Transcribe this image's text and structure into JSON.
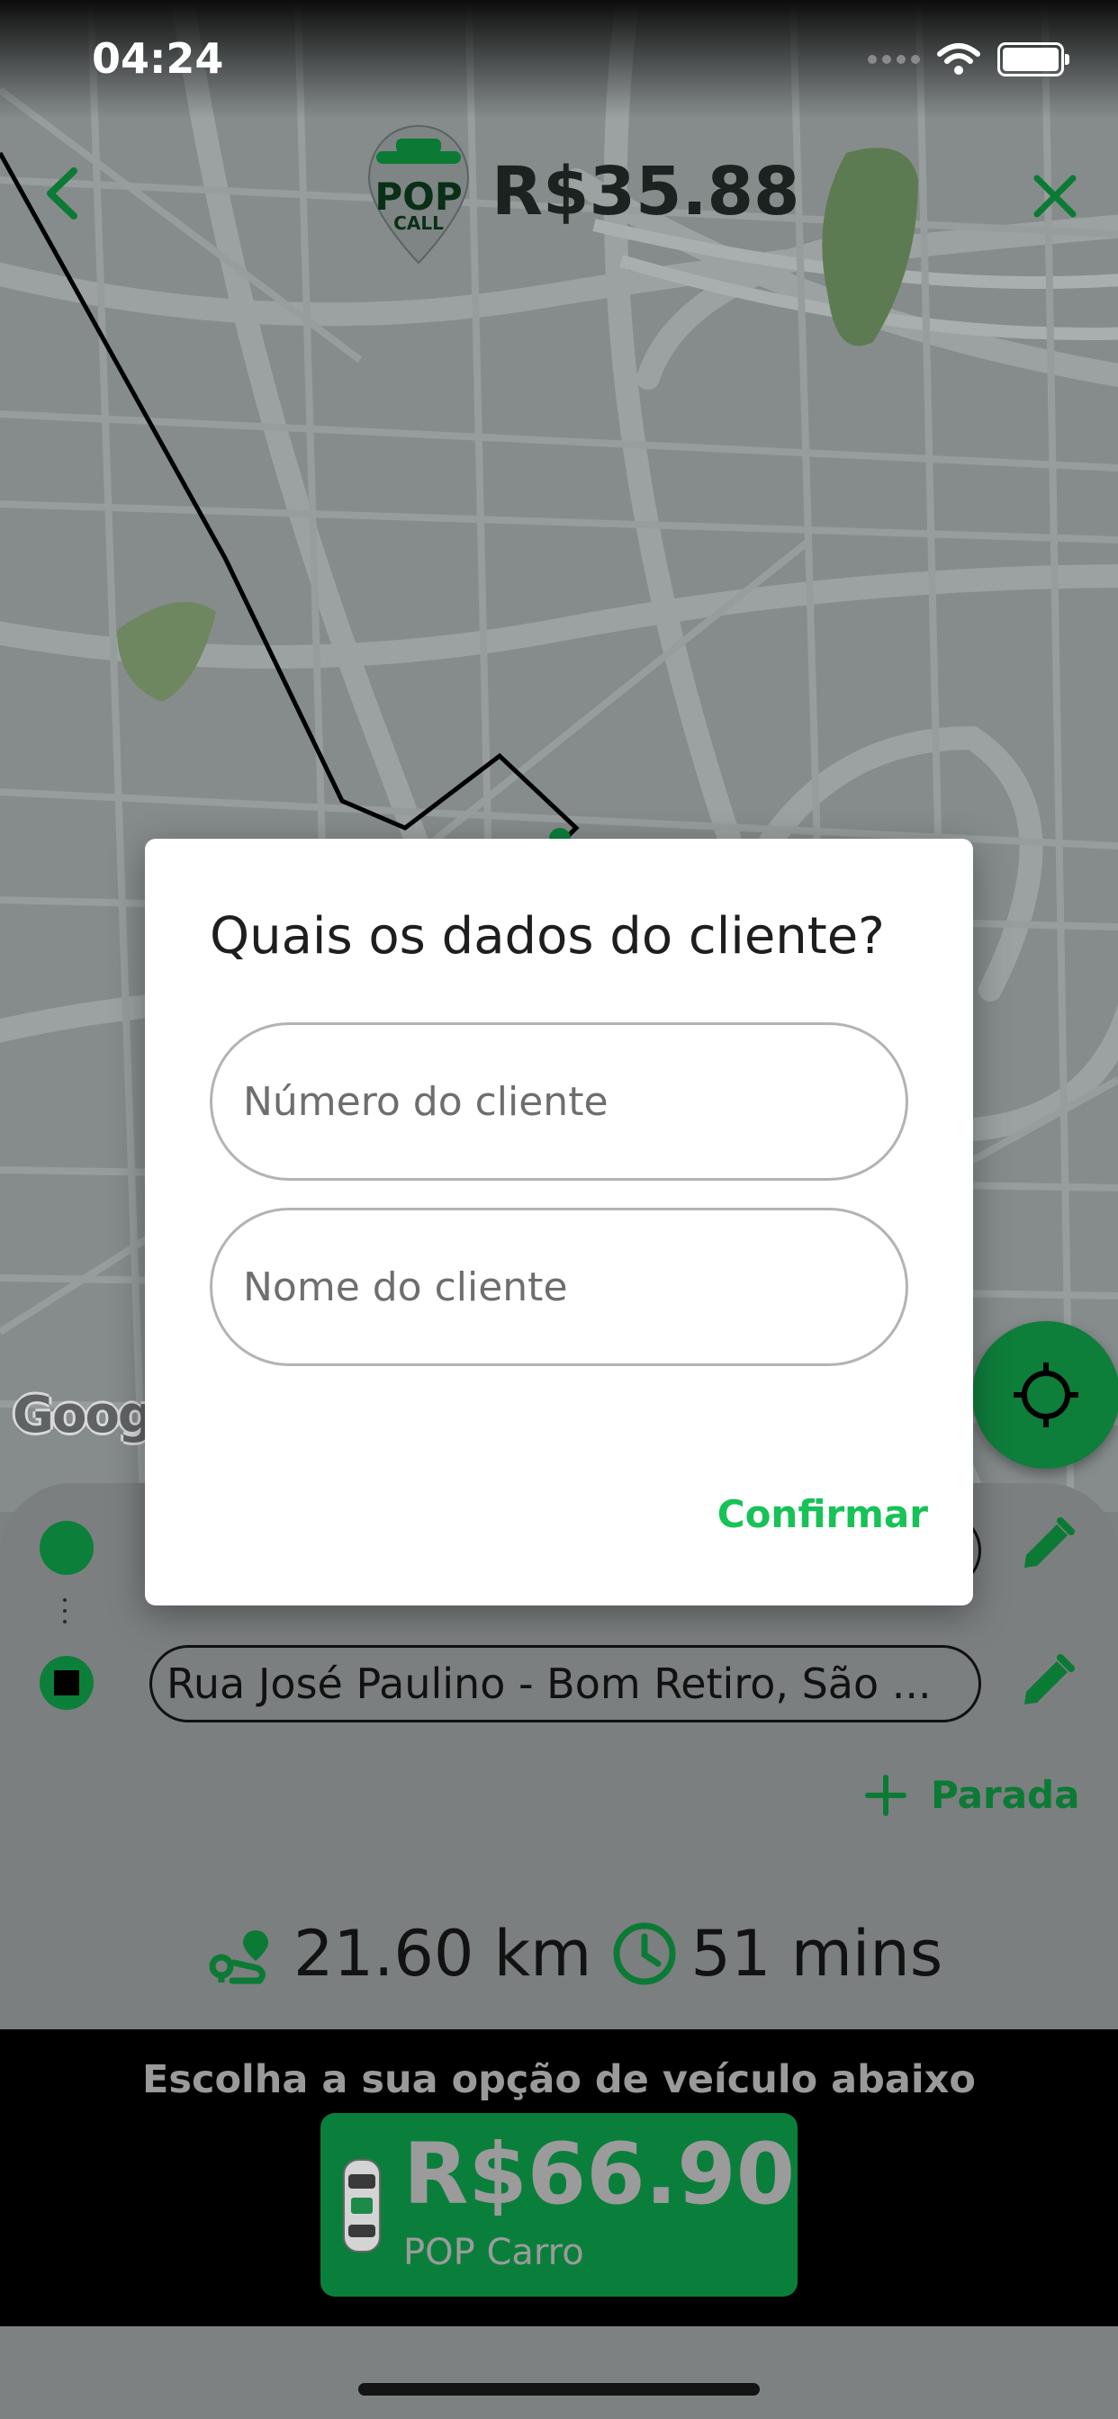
{
  "status_bar": {
    "time": "04:24"
  },
  "header": {
    "price": "R$35.88"
  },
  "logo": {
    "text": "POP",
    "subtext": "CALL"
  },
  "map": {
    "attribution": "Google"
  },
  "route": {
    "origin_address": "",
    "destination_address": "Rua José Paulino - Bom Retiro, São ...",
    "add_stop_label": "Parada",
    "distance": "21.60 km",
    "duration": "51 mins"
  },
  "vehicle": {
    "prompt": "Escolha a sua opção de veículo abaixo",
    "price": "R$66.90",
    "name": "POP Carro"
  },
  "dialog": {
    "title": "Quais os dados do cliente?",
    "number_placeholder": "Número do cliente",
    "name_placeholder": "Nome do cliente",
    "confirm_label": "Confirmar"
  },
  "colors": {
    "brand_green": "#0a7f3b",
    "confirm_green": "#17c257",
    "overlay": "#7c8181"
  }
}
